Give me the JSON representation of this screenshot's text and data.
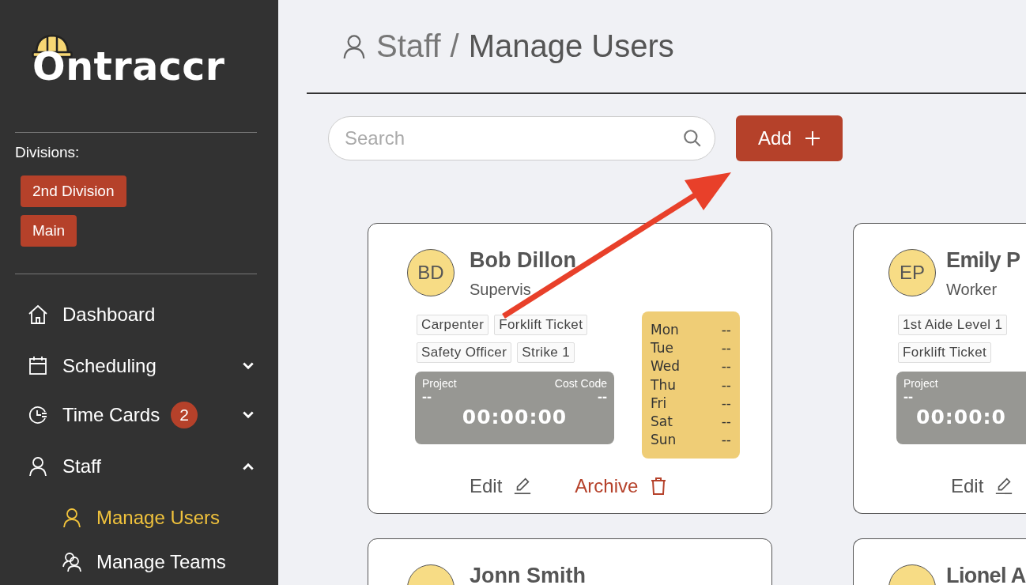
{
  "sidebar": {
    "logo": "Ontraccr",
    "divisions_label": "Divisions:",
    "divisions": [
      {
        "label": "2nd Division"
      },
      {
        "label": "Main"
      }
    ],
    "nav": [
      {
        "label": "Dashboard"
      },
      {
        "label": "Scheduling",
        "expanded": false
      },
      {
        "label": "Time Cards",
        "expanded": false,
        "badge": "2"
      },
      {
        "label": "Staff",
        "expanded": true,
        "children": [
          {
            "label": "Manage Users",
            "selected": true
          },
          {
            "label": "Manage Teams",
            "selected": false
          }
        ]
      }
    ]
  },
  "breadcrumb": {
    "items": [
      {
        "label": "Staff"
      },
      {
        "label": "Manage Users"
      }
    ],
    "separator": "/"
  },
  "search": {
    "placeholder": "Search"
  },
  "add_button": {
    "label": "Add"
  },
  "users": [
    {
      "initials": "BD",
      "name": "Bob Dillon",
      "role": "Supervis",
      "tags": [
        "Carpenter",
        "Forklift Ticket",
        "Safety Officer",
        "Strike 1"
      ],
      "timer": {
        "project_label": "Project",
        "project": "--",
        "cost_code_label": "Cost Code",
        "cost_code": "--",
        "time": "00:00:00"
      },
      "schedule": [
        {
          "day": "Mon",
          "value": "--"
        },
        {
          "day": "Tue",
          "value": "--"
        },
        {
          "day": "Wed",
          "value": "--"
        },
        {
          "day": "Thu",
          "value": "--"
        },
        {
          "day": "Fri",
          "value": "--"
        },
        {
          "day": "Sat",
          "value": "--"
        },
        {
          "day": "Sun",
          "value": "--"
        }
      ],
      "actions": [
        {
          "label": "Edit",
          "kind": "edit"
        },
        {
          "label": "Archive",
          "kind": "archive"
        }
      ]
    },
    {
      "initials": "EP",
      "name": "Emily P",
      "role": "Worker",
      "tags": [
        "1st Aide Level 1",
        "Forklift Ticket"
      ],
      "timer": {
        "project_label": "Project",
        "project": "--",
        "time": "00:00:0"
      },
      "actions": [
        {
          "label": "Edit",
          "kind": "edit"
        }
      ]
    },
    {
      "name": "Jonn Smith"
    },
    {
      "name": "Lionel A"
    }
  ]
}
